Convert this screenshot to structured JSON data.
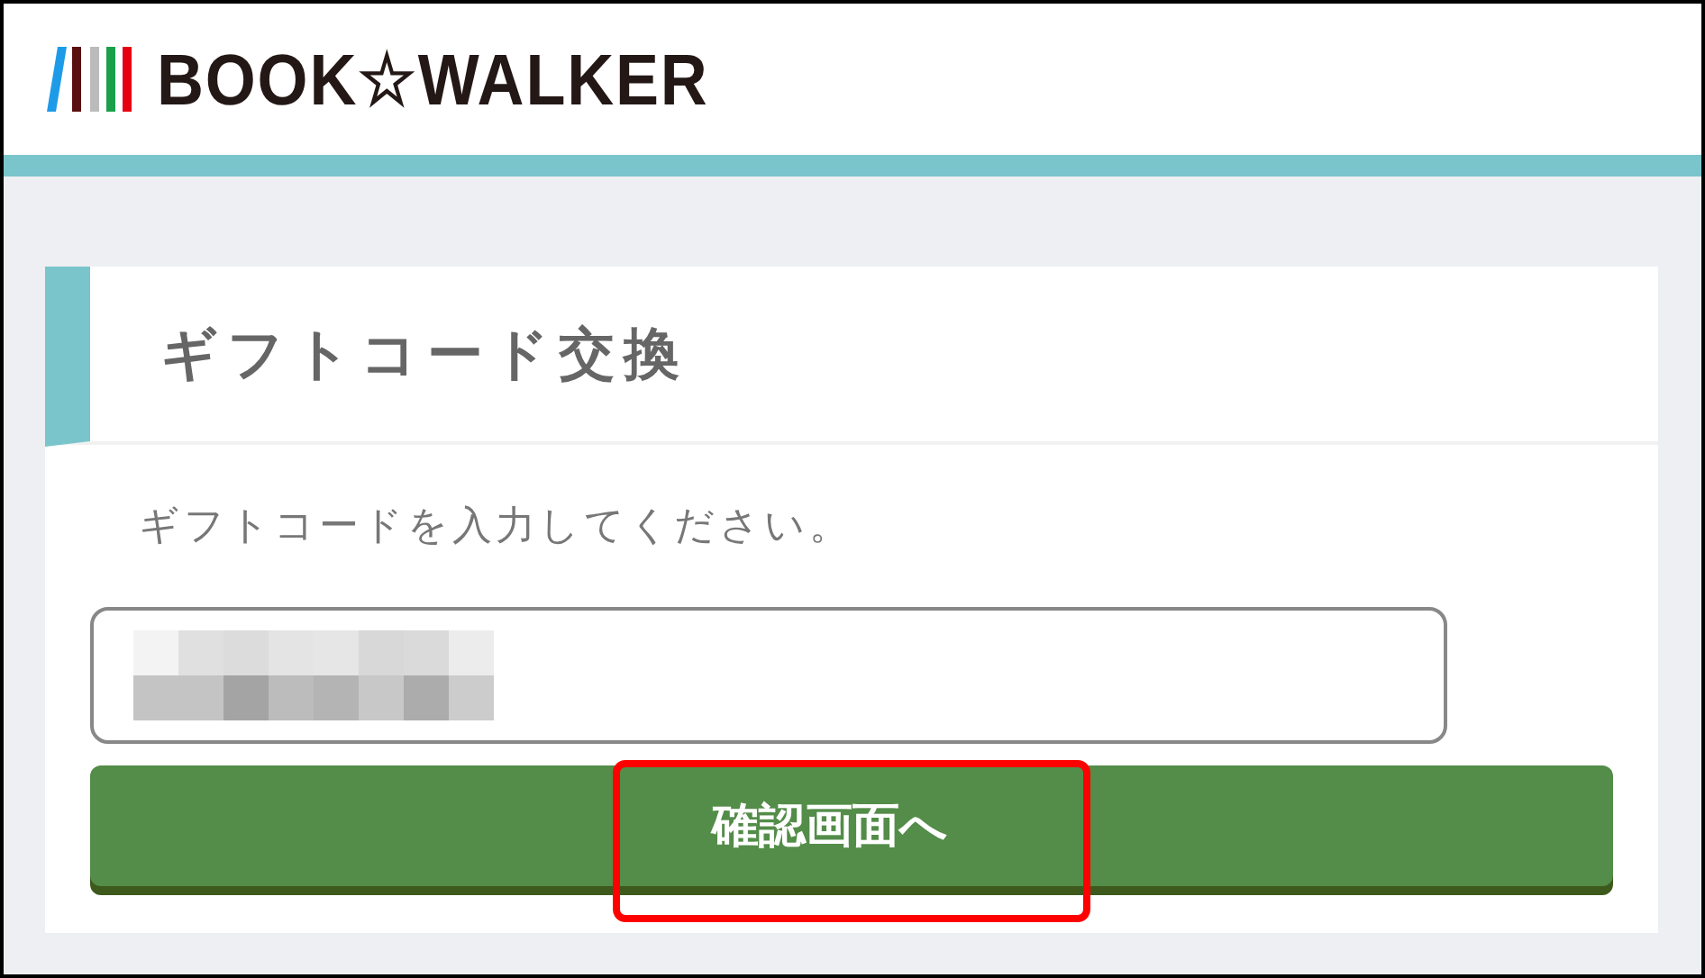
{
  "header": {
    "logo_text": "BOOK☆WALKER"
  },
  "card": {
    "title": "ギフトコード交換",
    "prompt": "ギフトコードを入力してください。",
    "gift_code_field": {
      "redacted": true
    },
    "confirm_button": "確認画面へ"
  },
  "annotations": [
    {
      "kind": "highlight-rectangle"
    }
  ]
}
